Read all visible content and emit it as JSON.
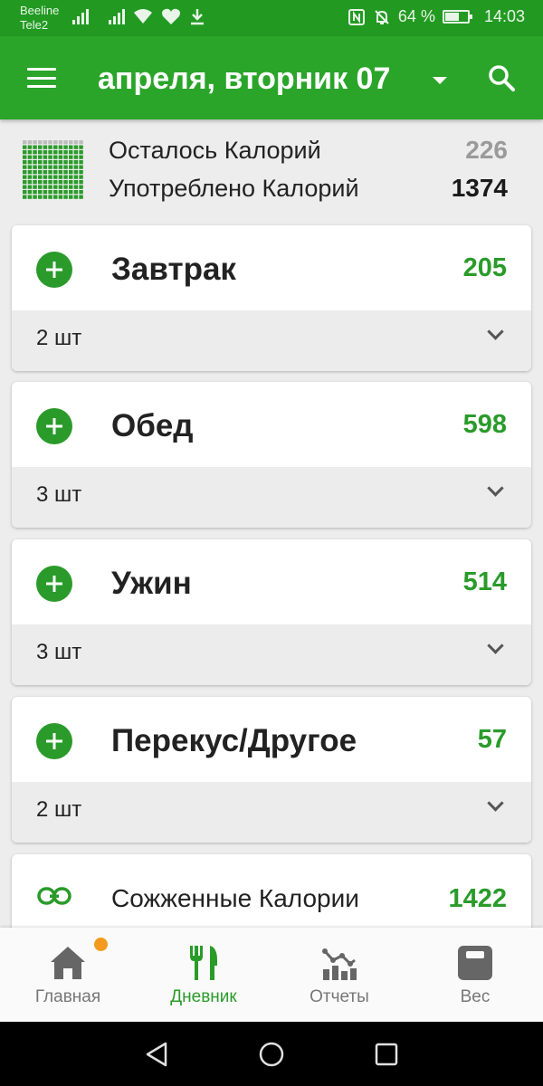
{
  "status_bar": {
    "carrier_1": "Beeline",
    "carrier_2": "Tele2",
    "battery_text": "64 %",
    "battery_level": 0.64,
    "time": "14:03"
  },
  "header": {
    "title": "апреля, вторник 07",
    "icons": [
      "menu-icon",
      "dropdown-icon",
      "search-icon"
    ]
  },
  "summary": {
    "remaining_label": "Осталось Калорий",
    "remaining_value": "226",
    "consumed_label": "Употреблено Калорий",
    "consumed_value": "1374"
  },
  "meals": [
    {
      "name": "Завтрак",
      "kcal": "205",
      "count": "2 шт"
    },
    {
      "name": "Обед",
      "kcal": "598",
      "count": "3 шт"
    },
    {
      "name": "Ужин",
      "kcal": "514",
      "count": "3 шт"
    },
    {
      "name": "Перекус/Другое",
      "kcal": "57",
      "count": "2 шт"
    }
  ],
  "burned": {
    "label": "Сожженные Калории",
    "value": "1422"
  },
  "bottom_nav": [
    {
      "label": "Главная",
      "icon": "home-icon",
      "active": false,
      "badge": true
    },
    {
      "label": "Дневник",
      "icon": "fork-knife-icon",
      "active": true,
      "badge": false
    },
    {
      "label": "Отчеты",
      "icon": "reports-icon",
      "active": false,
      "badge": false
    },
    {
      "label": "Вес",
      "icon": "scale-icon",
      "active": false,
      "badge": false
    }
  ],
  "colors": {
    "primary": "#2aa52a",
    "status_bar": "#229a22",
    "accent_text": "#2a9b2a",
    "badge": "#f39a1e"
  }
}
